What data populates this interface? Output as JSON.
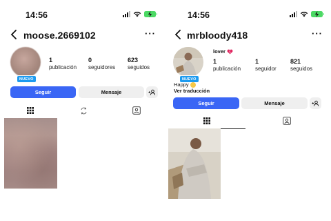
{
  "left": {
    "status": {
      "time": "14:56"
    },
    "header": {
      "username": "moose.2669102",
      "more": "···"
    },
    "avatar": {
      "badge": "NUEVO"
    },
    "stats": [
      {
        "value": "1",
        "label": "publicación"
      },
      {
        "value": "0",
        "label": "seguidores"
      },
      {
        "value": "623",
        "label": "seguidos"
      }
    ],
    "buttons": {
      "follow": "Seguir",
      "message": "Mensaje"
    },
    "tabs": [
      "grid-icon",
      "reels-icon",
      "tagged-icon"
    ]
  },
  "right": {
    "status": {
      "time": "14:56"
    },
    "header": {
      "username": "mrbloody418",
      "more": "···"
    },
    "avatar": {
      "badge": "NUEVO"
    },
    "bio": {
      "name": "lover",
      "text": "Happy",
      "translate": "Ver traducción"
    },
    "stats": [
      {
        "value": "1",
        "label": "publicación"
      },
      {
        "value": "1",
        "label": "seguidor"
      },
      {
        "value": "821",
        "label": "seguidos"
      }
    ],
    "buttons": {
      "follow": "Seguir",
      "message": "Mensaje"
    },
    "tabs": [
      "grid-icon",
      "tagged-icon"
    ]
  },
  "colors": {
    "primary_button": "#3a66f5",
    "secondary_button": "#efefef",
    "badge": "#1d9bf0",
    "battery": "#4cd964"
  }
}
